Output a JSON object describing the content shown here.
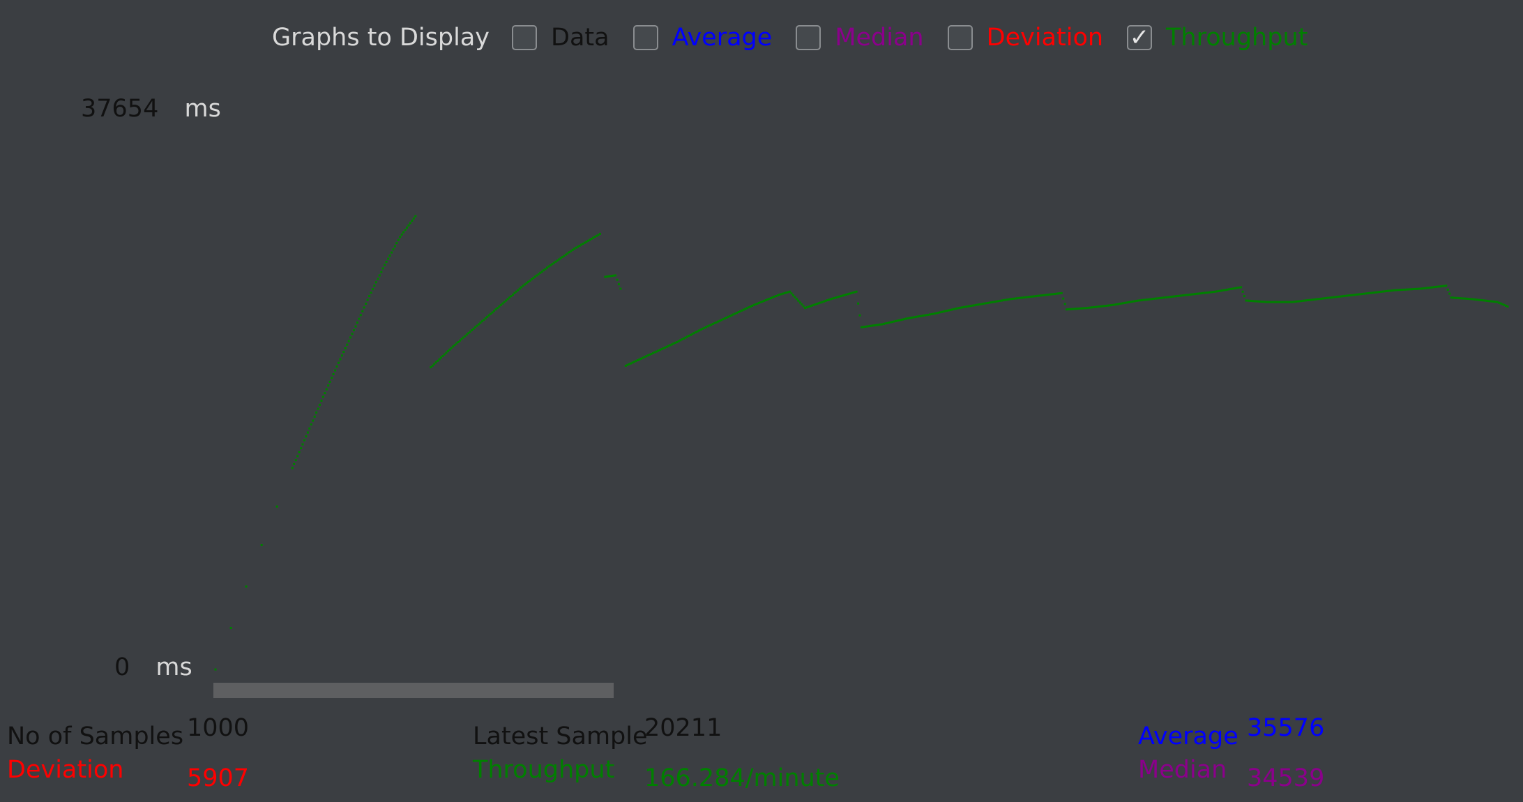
{
  "controls": {
    "title": "Graphs to Display",
    "options": [
      {
        "label": "Data",
        "checked": false,
        "color": "#111111"
      },
      {
        "label": "Average",
        "checked": false,
        "color": "#0000ff"
      },
      {
        "label": "Median",
        "checked": false,
        "color": "#8b008b"
      },
      {
        "label": "Deviation",
        "checked": false,
        "color": "#ff0000"
      },
      {
        "label": "Throughput",
        "checked": true,
        "color": "#008000"
      }
    ]
  },
  "graph": {
    "y_max_label": "37654",
    "y_min_label": "0",
    "unit": "ms"
  },
  "stats": {
    "samples_label": "No of Samples",
    "samples_value": "1000",
    "deviation_label": "Deviation",
    "deviation_value": "5907",
    "latest_label": "Latest Sample",
    "latest_value": "20211",
    "throughput_label": "Throughput",
    "throughput_value": "166.284/minute",
    "average_label": "Average",
    "average_value": "35576",
    "median_label": "Median",
    "median_value": "34539"
  },
  "colors": {
    "background": "#3b3e42",
    "throughput": "#008000",
    "average": "#0000ff",
    "median": "#8b008b",
    "deviation": "#ff0000",
    "label_dark": "#111111",
    "label_light": "#d9d9d9"
  },
  "chart_data": {
    "type": "scatter",
    "series": [
      {
        "name": "Throughput",
        "points": [
          [
            0,
            0
          ],
          [
            3,
            2.8
          ],
          [
            6,
            5.6
          ],
          [
            9,
            8.4
          ],
          [
            12,
            11.0
          ],
          [
            15,
            13.6
          ],
          [
            18,
            16.0
          ],
          [
            21,
            18.4
          ],
          [
            24,
            20.7
          ],
          [
            27,
            22.9
          ],
          [
            30,
            25.2
          ],
          [
            33,
            27.3
          ],
          [
            36,
            29.2
          ],
          [
            39,
            30.6
          ],
          [
            42,
            20.4
          ],
          [
            46,
            21.7
          ],
          [
            50,
            22.9
          ],
          [
            55,
            24.4
          ],
          [
            60,
            25.9
          ],
          [
            65,
            27.2
          ],
          [
            70,
            28.4
          ],
          [
            75,
            29.4
          ],
          [
            76,
            26.5
          ],
          [
            78,
            26.6
          ],
          [
            79,
            25.7
          ],
          [
            80,
            20.5
          ],
          [
            85,
            21.3
          ],
          [
            90,
            22.1
          ],
          [
            95,
            23.0
          ],
          [
            100,
            23.8
          ],
          [
            105,
            24.6
          ],
          [
            110,
            25.3
          ],
          [
            112,
            25.5
          ],
          [
            115,
            24.4
          ],
          [
            120,
            25.0
          ],
          [
            125,
            25.5
          ],
          [
            126,
            23.1
          ],
          [
            130,
            23.3
          ],
          [
            135,
            23.7
          ],
          [
            140,
            24.0
          ],
          [
            145,
            24.4
          ],
          [
            150,
            24.7
          ],
          [
            155,
            25.0
          ],
          [
            160,
            25.2
          ],
          [
            165,
            25.4
          ],
          [
            166,
            24.3
          ],
          [
            170,
            24.4
          ],
          [
            175,
            24.6
          ],
          [
            180,
            24.9
          ],
          [
            185,
            25.1
          ],
          [
            190,
            25.3
          ],
          [
            195,
            25.5
          ],
          [
            200,
            25.8
          ],
          [
            201,
            24.9
          ],
          [
            205,
            24.8
          ],
          [
            210,
            24.8
          ],
          [
            215,
            25.0
          ],
          [
            220,
            25.2
          ],
          [
            225,
            25.4
          ],
          [
            230,
            25.6
          ],
          [
            235,
            25.7
          ],
          [
            240,
            25.9
          ],
          [
            241,
            25.1
          ],
          [
            245,
            25.0
          ],
          [
            250,
            24.8
          ],
          [
            252,
            24.5
          ]
        ]
      }
    ],
    "ylim": [
      0,
      37654
    ],
    "ylabel": "ms"
  }
}
